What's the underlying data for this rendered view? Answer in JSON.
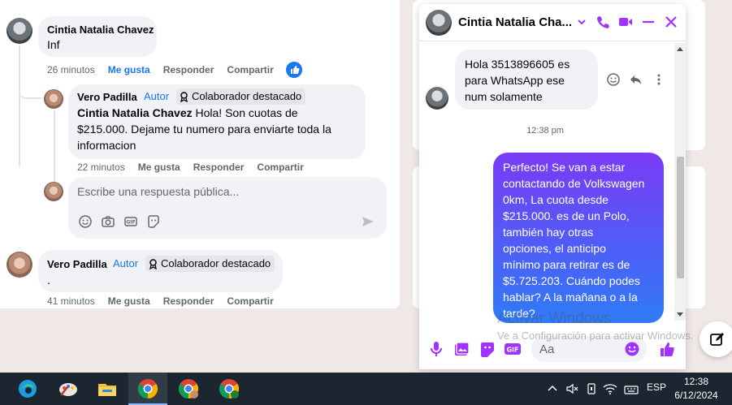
{
  "comments": [
    {
      "name": "Cintia Natalia Chavez",
      "text": "Inf",
      "time": "26 minutos",
      "like": "Me gusta",
      "reply": "Responder",
      "share": "Compartir"
    },
    {
      "name": "Vero Padilla",
      "author_tag": "Autor",
      "badge": "Colaborador destacado",
      "mention": "Cintia Natalia Chavez",
      "text_line1": " Hola! Son cuotas de",
      "text_line2": "$215.000. Dejame tu numero para enviarte toda la",
      "text_line3": "informacion",
      "time": "22 minutos",
      "like": "Me gusta",
      "reply": "Responder",
      "share": "Compartir"
    },
    {
      "name": "Vero Padilla",
      "author_tag": "Autor",
      "badge": "Colaborador destacado",
      "text": ".",
      "time": "41 minutos",
      "like": "Me gusta",
      "reply": "Responder",
      "share": "Compartir"
    }
  ],
  "reply_box": {
    "placeholder": "Escribe una respuesta pública...",
    "icons": [
      "emoji-icon",
      "camera-icon",
      "gif-icon",
      "sticker-icon",
      "send-icon"
    ]
  },
  "chat": {
    "title": "Cintia Natalia Cha...",
    "incoming": [
      "Hola 3513896605 es",
      "para WhatsApp ese",
      "num solamente"
    ],
    "timestamp": "12:38 pm",
    "outgoing": [
      "Perfecto!  Se van a estar",
      "contactando de Volkswagen",
      "0km, La cuota desde",
      "$215.000. es de un Polo,",
      "también hay otras",
      "opciones, el anticipo",
      "mínimo para retirar es de",
      "$5.725.203. Cuándo podes",
      "hablar? A la mañana o a la",
      "tarde?"
    ],
    "input_placeholder": "Aa",
    "accent": "#a033ff"
  },
  "watermark": {
    "line1": "Activar Windows",
    "line2": "Ve a Configuración para activar Windows."
  },
  "taskbar": {
    "lang": "ESP",
    "time": "12:38",
    "date": "6/12/2024"
  }
}
